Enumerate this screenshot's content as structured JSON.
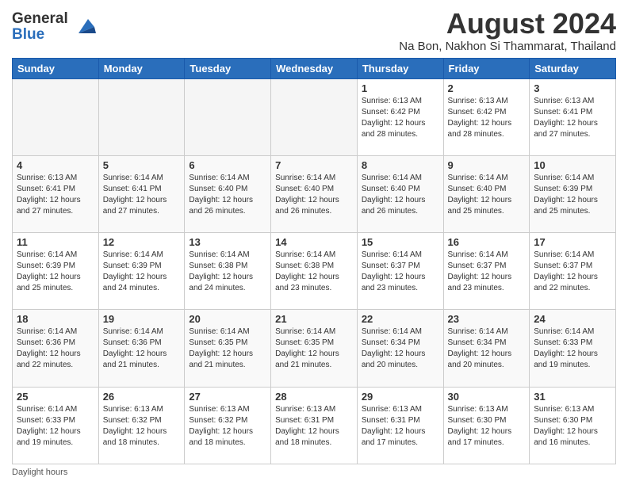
{
  "logo": {
    "general": "General",
    "blue": "Blue"
  },
  "title": "August 2024",
  "subtitle": "Na Bon, Nakhon Si Thammarat, Thailand",
  "days_header": [
    "Sunday",
    "Monday",
    "Tuesday",
    "Wednesday",
    "Thursday",
    "Friday",
    "Saturday"
  ],
  "footer": "Daylight hours",
  "weeks": [
    [
      {
        "day": "",
        "info": ""
      },
      {
        "day": "",
        "info": ""
      },
      {
        "day": "",
        "info": ""
      },
      {
        "day": "",
        "info": ""
      },
      {
        "day": "1",
        "info": "Sunrise: 6:13 AM\nSunset: 6:42 PM\nDaylight: 12 hours\nand 28 minutes."
      },
      {
        "day": "2",
        "info": "Sunrise: 6:13 AM\nSunset: 6:42 PM\nDaylight: 12 hours\nand 28 minutes."
      },
      {
        "day": "3",
        "info": "Sunrise: 6:13 AM\nSunset: 6:41 PM\nDaylight: 12 hours\nand 27 minutes."
      }
    ],
    [
      {
        "day": "4",
        "info": "Sunrise: 6:13 AM\nSunset: 6:41 PM\nDaylight: 12 hours\nand 27 minutes."
      },
      {
        "day": "5",
        "info": "Sunrise: 6:14 AM\nSunset: 6:41 PM\nDaylight: 12 hours\nand 27 minutes."
      },
      {
        "day": "6",
        "info": "Sunrise: 6:14 AM\nSunset: 6:40 PM\nDaylight: 12 hours\nand 26 minutes."
      },
      {
        "day": "7",
        "info": "Sunrise: 6:14 AM\nSunset: 6:40 PM\nDaylight: 12 hours\nand 26 minutes."
      },
      {
        "day": "8",
        "info": "Sunrise: 6:14 AM\nSunset: 6:40 PM\nDaylight: 12 hours\nand 26 minutes."
      },
      {
        "day": "9",
        "info": "Sunrise: 6:14 AM\nSunset: 6:40 PM\nDaylight: 12 hours\nand 25 minutes."
      },
      {
        "day": "10",
        "info": "Sunrise: 6:14 AM\nSunset: 6:39 PM\nDaylight: 12 hours\nand 25 minutes."
      }
    ],
    [
      {
        "day": "11",
        "info": "Sunrise: 6:14 AM\nSunset: 6:39 PM\nDaylight: 12 hours\nand 25 minutes."
      },
      {
        "day": "12",
        "info": "Sunrise: 6:14 AM\nSunset: 6:39 PM\nDaylight: 12 hours\nand 24 minutes."
      },
      {
        "day": "13",
        "info": "Sunrise: 6:14 AM\nSunset: 6:38 PM\nDaylight: 12 hours\nand 24 minutes."
      },
      {
        "day": "14",
        "info": "Sunrise: 6:14 AM\nSunset: 6:38 PM\nDaylight: 12 hours\nand 23 minutes."
      },
      {
        "day": "15",
        "info": "Sunrise: 6:14 AM\nSunset: 6:37 PM\nDaylight: 12 hours\nand 23 minutes."
      },
      {
        "day": "16",
        "info": "Sunrise: 6:14 AM\nSunset: 6:37 PM\nDaylight: 12 hours\nand 23 minutes."
      },
      {
        "day": "17",
        "info": "Sunrise: 6:14 AM\nSunset: 6:37 PM\nDaylight: 12 hours\nand 22 minutes."
      }
    ],
    [
      {
        "day": "18",
        "info": "Sunrise: 6:14 AM\nSunset: 6:36 PM\nDaylight: 12 hours\nand 22 minutes."
      },
      {
        "day": "19",
        "info": "Sunrise: 6:14 AM\nSunset: 6:36 PM\nDaylight: 12 hours\nand 21 minutes."
      },
      {
        "day": "20",
        "info": "Sunrise: 6:14 AM\nSunset: 6:35 PM\nDaylight: 12 hours\nand 21 minutes."
      },
      {
        "day": "21",
        "info": "Sunrise: 6:14 AM\nSunset: 6:35 PM\nDaylight: 12 hours\nand 21 minutes."
      },
      {
        "day": "22",
        "info": "Sunrise: 6:14 AM\nSunset: 6:34 PM\nDaylight: 12 hours\nand 20 minutes."
      },
      {
        "day": "23",
        "info": "Sunrise: 6:14 AM\nSunset: 6:34 PM\nDaylight: 12 hours\nand 20 minutes."
      },
      {
        "day": "24",
        "info": "Sunrise: 6:14 AM\nSunset: 6:33 PM\nDaylight: 12 hours\nand 19 minutes."
      }
    ],
    [
      {
        "day": "25",
        "info": "Sunrise: 6:14 AM\nSunset: 6:33 PM\nDaylight: 12 hours\nand 19 minutes."
      },
      {
        "day": "26",
        "info": "Sunrise: 6:13 AM\nSunset: 6:32 PM\nDaylight: 12 hours\nand 18 minutes."
      },
      {
        "day": "27",
        "info": "Sunrise: 6:13 AM\nSunset: 6:32 PM\nDaylight: 12 hours\nand 18 minutes."
      },
      {
        "day": "28",
        "info": "Sunrise: 6:13 AM\nSunset: 6:31 PM\nDaylight: 12 hours\nand 18 minutes."
      },
      {
        "day": "29",
        "info": "Sunrise: 6:13 AM\nSunset: 6:31 PM\nDaylight: 12 hours\nand 17 minutes."
      },
      {
        "day": "30",
        "info": "Sunrise: 6:13 AM\nSunset: 6:30 PM\nDaylight: 12 hours\nand 17 minutes."
      },
      {
        "day": "31",
        "info": "Sunrise: 6:13 AM\nSunset: 6:30 PM\nDaylight: 12 hours\nand 16 minutes."
      }
    ]
  ]
}
